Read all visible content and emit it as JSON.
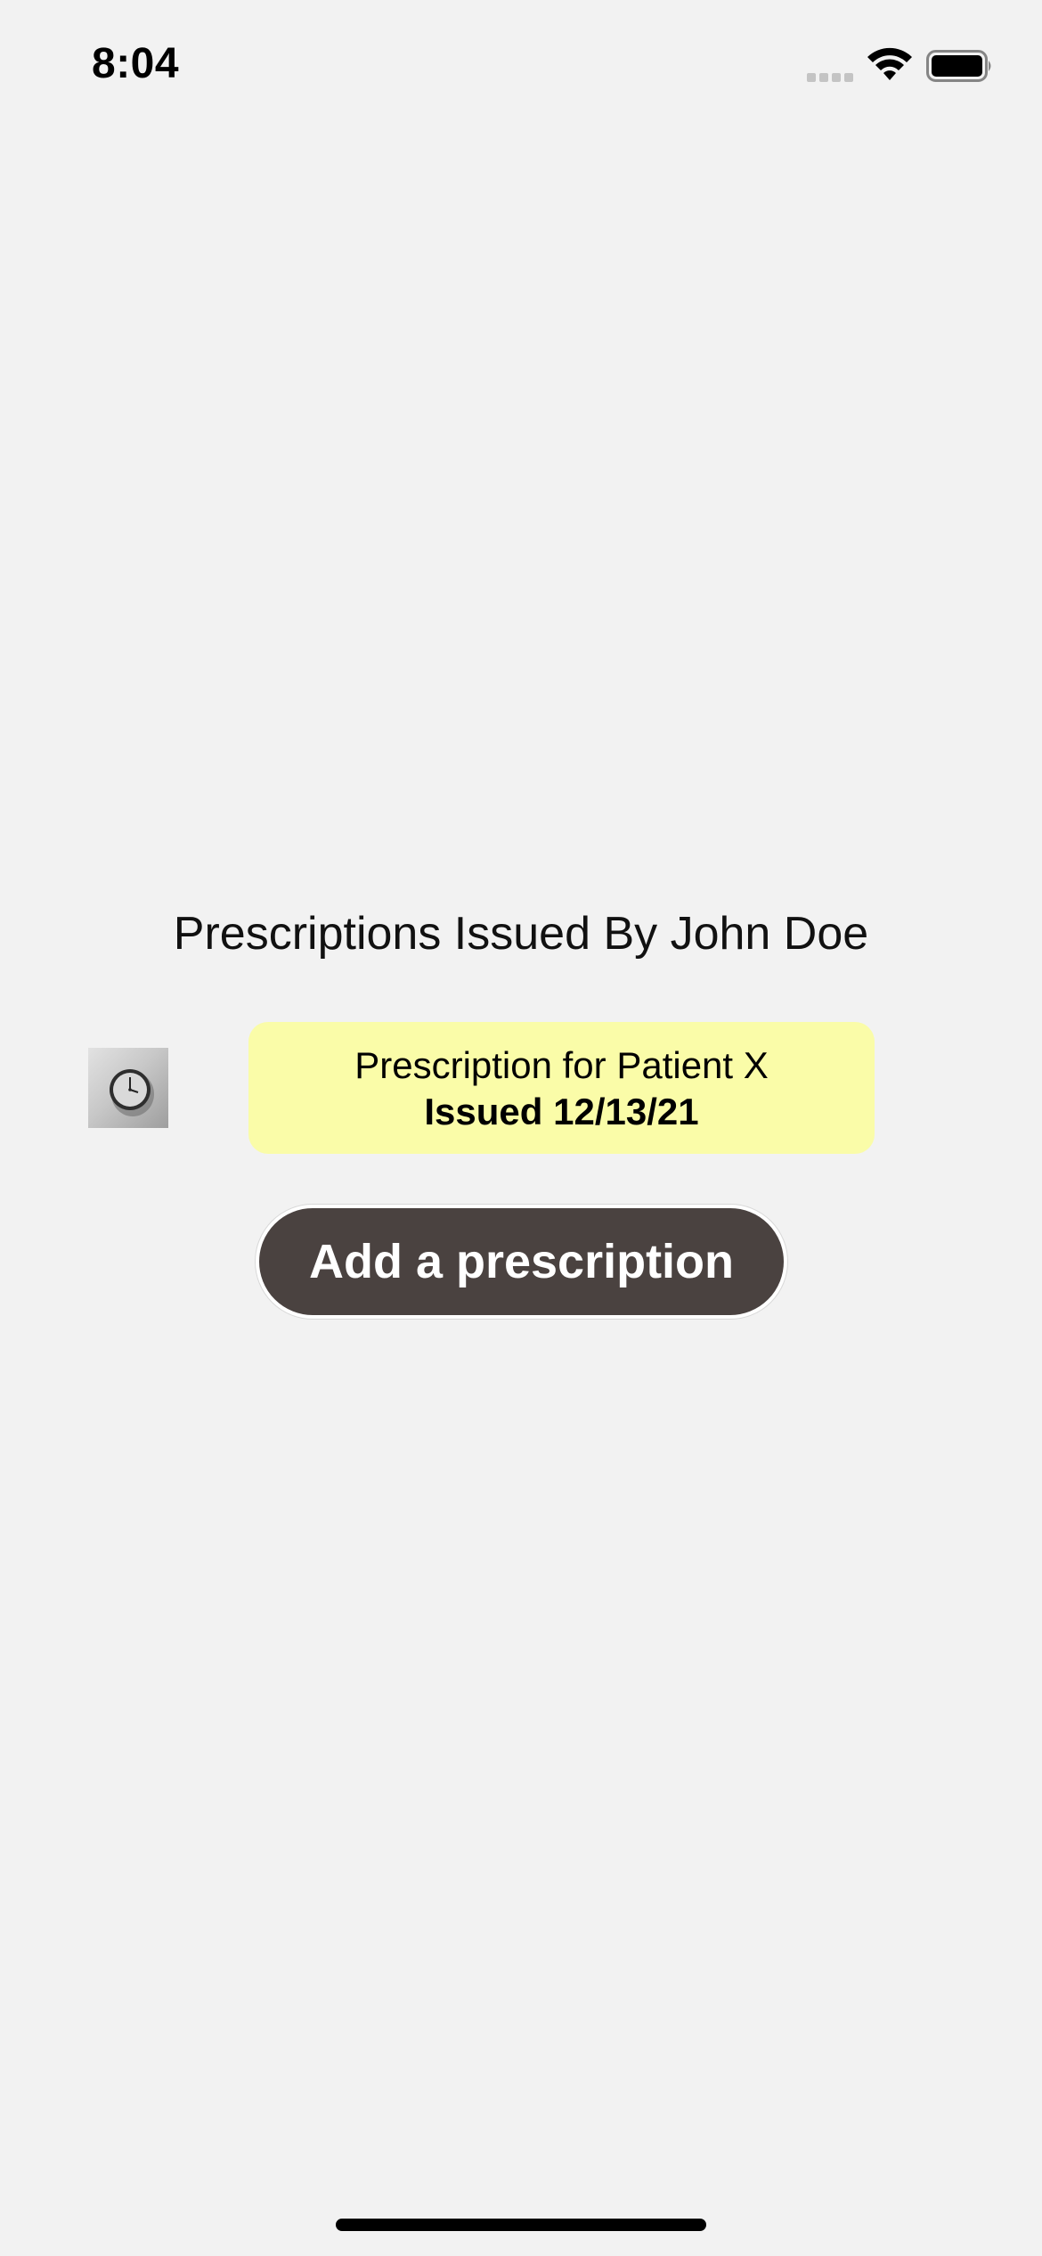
{
  "status_bar": {
    "time": "8:04",
    "icons": [
      "cellular-signal-icon",
      "wifi-icon",
      "battery-icon"
    ]
  },
  "main": {
    "title": "Prescriptions Issued By John Doe",
    "prescriptions": [
      {
        "thumbnail_icon": "clock-icon",
        "title": "Prescription for Patient X",
        "issued": "Issued 12/13/21"
      }
    ],
    "add_button_label": "Add a prescription"
  },
  "colors": {
    "background": "#f2f2f2",
    "card": "#fafca8",
    "button": "#4a4240",
    "button_text": "#ffffff"
  }
}
